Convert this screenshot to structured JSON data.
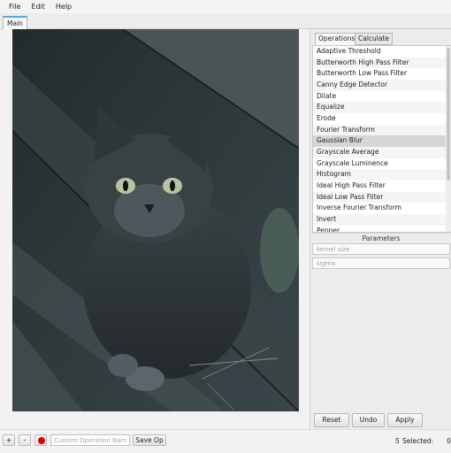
{
  "menu": [
    "File",
    "Edit",
    "Help"
  ],
  "main_tab": "Main",
  "side_tabs": [
    "Operations",
    "Calculate"
  ],
  "operations": [
    "Adaptive Threshold",
    "Butterworth High Pass Filter",
    "Butterworth Low Pass Filter",
    "Canny Edge Detector",
    "Dilate",
    "Equalize",
    "Erode",
    "Fourier Transform",
    "Gaussian Blur",
    "Grayscale Average",
    "Grayscale Luminence",
    "Histogram",
    "Ideal High Pass Filter",
    "Ideal Low Pass Filter",
    "Inverse Fourier Transform",
    "Invert",
    "Pepper"
  ],
  "selected_operation": "Gaussian Blur",
  "parameters": {
    "header": "Parameters",
    "kernel_placeholder": "kernel size",
    "sigma_placeholder": "sigma"
  },
  "actions": {
    "reset": "Reset",
    "undo": "Undo",
    "apply": "Apply"
  },
  "bottom": {
    "add": "+",
    "remove": "-",
    "custom_placeholder": "Custom Operation Nam",
    "save_op": "Save Op",
    "count": "5",
    "selected_label": "Selected:",
    "selected_value": "0"
  },
  "colors": {
    "accent": "#5fa7d8",
    "record": "#e00000",
    "selection": "#d6d6d6"
  },
  "icons": {
    "record": "record-icon"
  }
}
